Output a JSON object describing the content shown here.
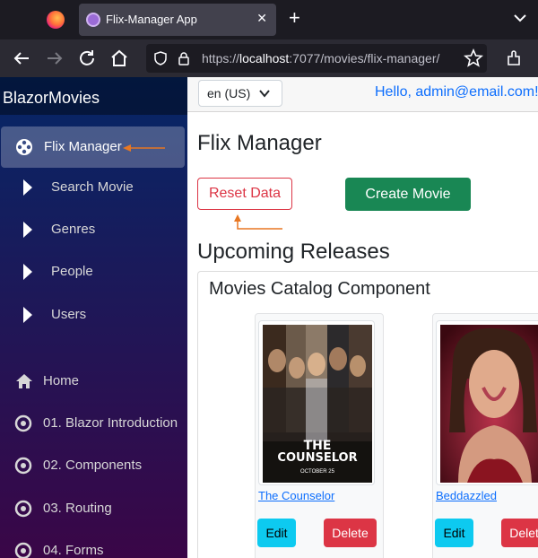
{
  "browser": {
    "tab_title": "Flix-Manager App",
    "tab_close": "✕",
    "new_tab": "+",
    "url_prefix": "https://",
    "url_host": "localhost",
    "url_rest": ":7077/movies/flix-manager/"
  },
  "sidebar": {
    "brand": "BlazorMovies",
    "flix_manager": "Flix Manager",
    "sub_items": [
      "Search Movie",
      "Genres",
      "People",
      "Users"
    ],
    "home": "Home",
    "lessons": [
      "01. Blazor Introduction",
      "02. Components",
      "03. Routing",
      "04. Forms"
    ]
  },
  "topbar": {
    "culture": "en (US)",
    "greeting": "Hello, admin@email.com!"
  },
  "main": {
    "title": "Flix Manager",
    "reset_label": "Reset Data",
    "create_label": "Create Movie",
    "section_title": "Upcoming Releases",
    "catalog_title": "Movies Catalog Component",
    "movies": [
      {
        "title": "The Counselor",
        "poster_title": "THE",
        "poster_title2": "COUNSELOR",
        "poster_date": "OCTOBER 25",
        "edit": "Edit",
        "delete": "Delete"
      },
      {
        "title": "Beddazzled",
        "edit": "Edit",
        "delete": "Delete"
      }
    ]
  },
  "colors": {
    "annotation_arrow": "#e87722",
    "primary": "#0d6efd",
    "danger": "#dc3545",
    "success": "#198754",
    "info": "#0dcaf0"
  }
}
